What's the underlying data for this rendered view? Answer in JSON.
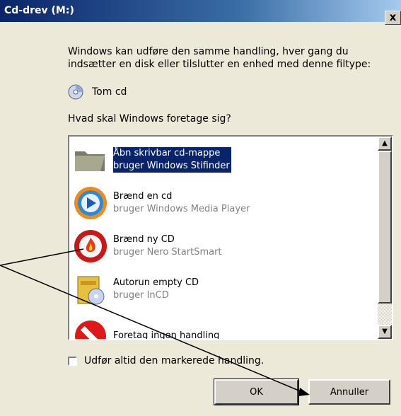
{
  "window": {
    "title": "Cd-drev (M:)",
    "close_label": "x"
  },
  "description": "Windows kan udføre den samme handling, hver gang du indsætter en disk eller tilslutter en enhed med denne filtype:",
  "media_type": {
    "icon": "cd-icon",
    "label": "Tom cd"
  },
  "question": "Hvad skal Windows foretage sig?",
  "actions": [
    {
      "name": "Åbn skrivbar cd-mappe",
      "sub": "bruger Windows Stifinder",
      "icon": "folder-icon",
      "selected": true
    },
    {
      "name": "Brænd en cd",
      "sub": "bruger Windows Media Player",
      "icon": "media-player-icon",
      "selected": false
    },
    {
      "name": "Brænd ny CD",
      "sub": "bruger Nero StartSmart",
      "icon": "nero-icon",
      "selected": false
    },
    {
      "name": "Autorun empty CD",
      "sub": "bruger InCD",
      "icon": "incd-icon",
      "selected": false
    },
    {
      "name": "Foretag ingen handling",
      "sub": "",
      "icon": "no-action-icon",
      "selected": false
    }
  ],
  "always_do": {
    "label": "Udfør altid den markerede handling.",
    "checked": false
  },
  "buttons": {
    "ok": "OK",
    "cancel": "Annuller"
  },
  "colors": {
    "selection": "#0a246a",
    "titlebar": "#0a246a",
    "dialog_bg": "#ece9d8"
  }
}
